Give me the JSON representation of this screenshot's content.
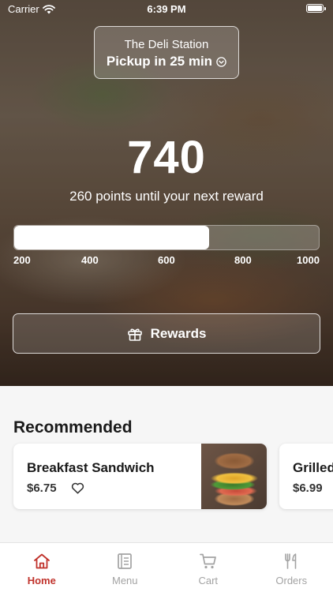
{
  "status_bar": {
    "carrier": "Carrier",
    "time": "6:39 PM"
  },
  "store": {
    "name": "The Deli Station",
    "pickup": "Pickup in 25 min"
  },
  "loyalty": {
    "points": "740",
    "next_reward_text": "260 points until your next reward",
    "progress_fraction": 0.64,
    "scale_labels": [
      "200",
      "400",
      "600",
      "800",
      "1000"
    ],
    "rewards_label": "Rewards"
  },
  "recommended": {
    "title": "Recommended",
    "items": [
      {
        "name": "Breakfast Sandwich",
        "price": "$6.75"
      },
      {
        "name": "Grilled",
        "price": "$6.99"
      }
    ]
  },
  "tabs": [
    {
      "label": "Home",
      "icon": "home-icon",
      "active": true
    },
    {
      "label": "Menu",
      "icon": "menu-icon",
      "active": false
    },
    {
      "label": "Cart",
      "icon": "cart-icon",
      "active": false
    },
    {
      "label": "Orders",
      "icon": "fork-knife-icon",
      "active": false
    }
  ],
  "colors": {
    "accent": "#c0322b",
    "inactive_tab": "#a3a3a3"
  }
}
